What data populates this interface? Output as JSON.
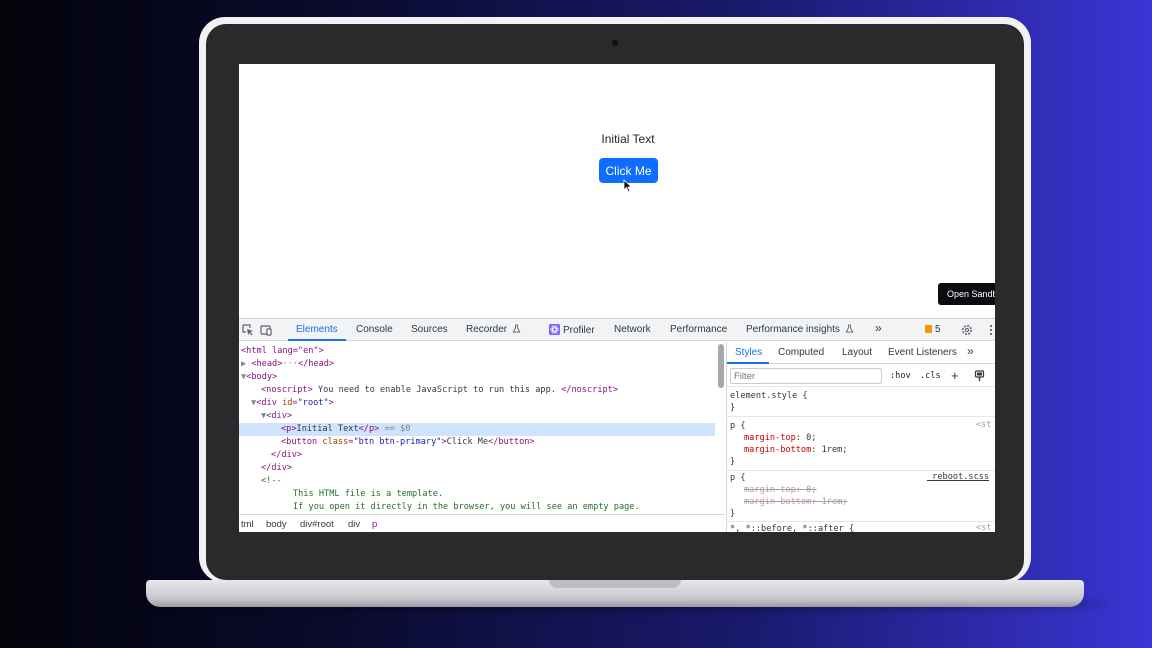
{
  "page": {
    "text": "Initial Text",
    "button_label": "Click Me",
    "sandbox_button": "Open Sandbox"
  },
  "devtools": {
    "tabs": [
      "Elements",
      "Console",
      "Sources",
      "Recorder",
      "Profiler",
      "Network",
      "Performance",
      "Performance insights"
    ],
    "active_tab": "Elements",
    "more_tabs": "»",
    "issues_count": "5",
    "elements_code": {
      "l1_open": "<html lang=\"en\">",
      "l2_head": "<head>",
      "l2_ellipsis": "···",
      "l2_head_close": "</head>",
      "l3_body": "<body>",
      "l4_noscript_open": "<noscript>",
      "l4_noscript_text": " You need to enable JavaScript to run this app. ",
      "l4_noscript_close": "</noscript>",
      "l5_div_open": "<div ",
      "l5_attr": "id",
      "l5_val": "\"root\"",
      "l5_close": ">",
      "l6_div": "<div>",
      "l7_p_open": "<p>",
      "l7_text": "Initial Text",
      "l7_p_close": "</p>",
      "l7_marker": " == $0",
      "l8_button_open": "<button ",
      "l8_attr": "class",
      "l8_val": "\"btn btn-primary\"",
      "l8_gt": ">",
      "l8_text": "Click Me",
      "l8_close": "</button>",
      "l9_div_close": "</div>",
      "l10_div_close": "</div>",
      "l11_comment_open": "<!--",
      "l12_comment": "This HTML file is a template.",
      "l13_comment": "If you open it directly in the browser, you will see an empty page."
    },
    "breadcrumbs": [
      "tml",
      "body",
      "div#root",
      "div",
      "p"
    ],
    "styles": {
      "tabs": [
        "Styles",
        "Computed",
        "Layout",
        "Event Listeners"
      ],
      "more": "»",
      "filter_placeholder": "Filter",
      "hov": ":hov",
      "cls": ".cls",
      "plus": "+",
      "element_style": "element.style {",
      "close_brace": "}",
      "rule1_selector": "p {",
      "rule1_source": "<st",
      "rule1_prop1": "margin-top",
      "rule1_val1": ": 0;",
      "rule1_prop2": "margin-bottom",
      "rule1_val2": ": 1rem;",
      "rule2_selector": "p {",
      "rule2_source": "_reboot.scss",
      "rule2_prop1": "margin-top",
      "rule2_val1": ": 0;",
      "rule2_prop2": "margin-bottom",
      "rule2_val2": ": 1rem;",
      "rule3_selector": "*, *::before, *::after {",
      "rule3_source": "<st"
    }
  },
  "colors": {
    "primary_button": "#0d6efd",
    "accent_blue": "#1a73e8",
    "tag_purple": "#881280",
    "attr_orange": "#994500",
    "value_blue": "#1a1aa6",
    "comment_green": "#236e25",
    "css_property_red": "#c80000",
    "issues_orange": "#f29900"
  }
}
